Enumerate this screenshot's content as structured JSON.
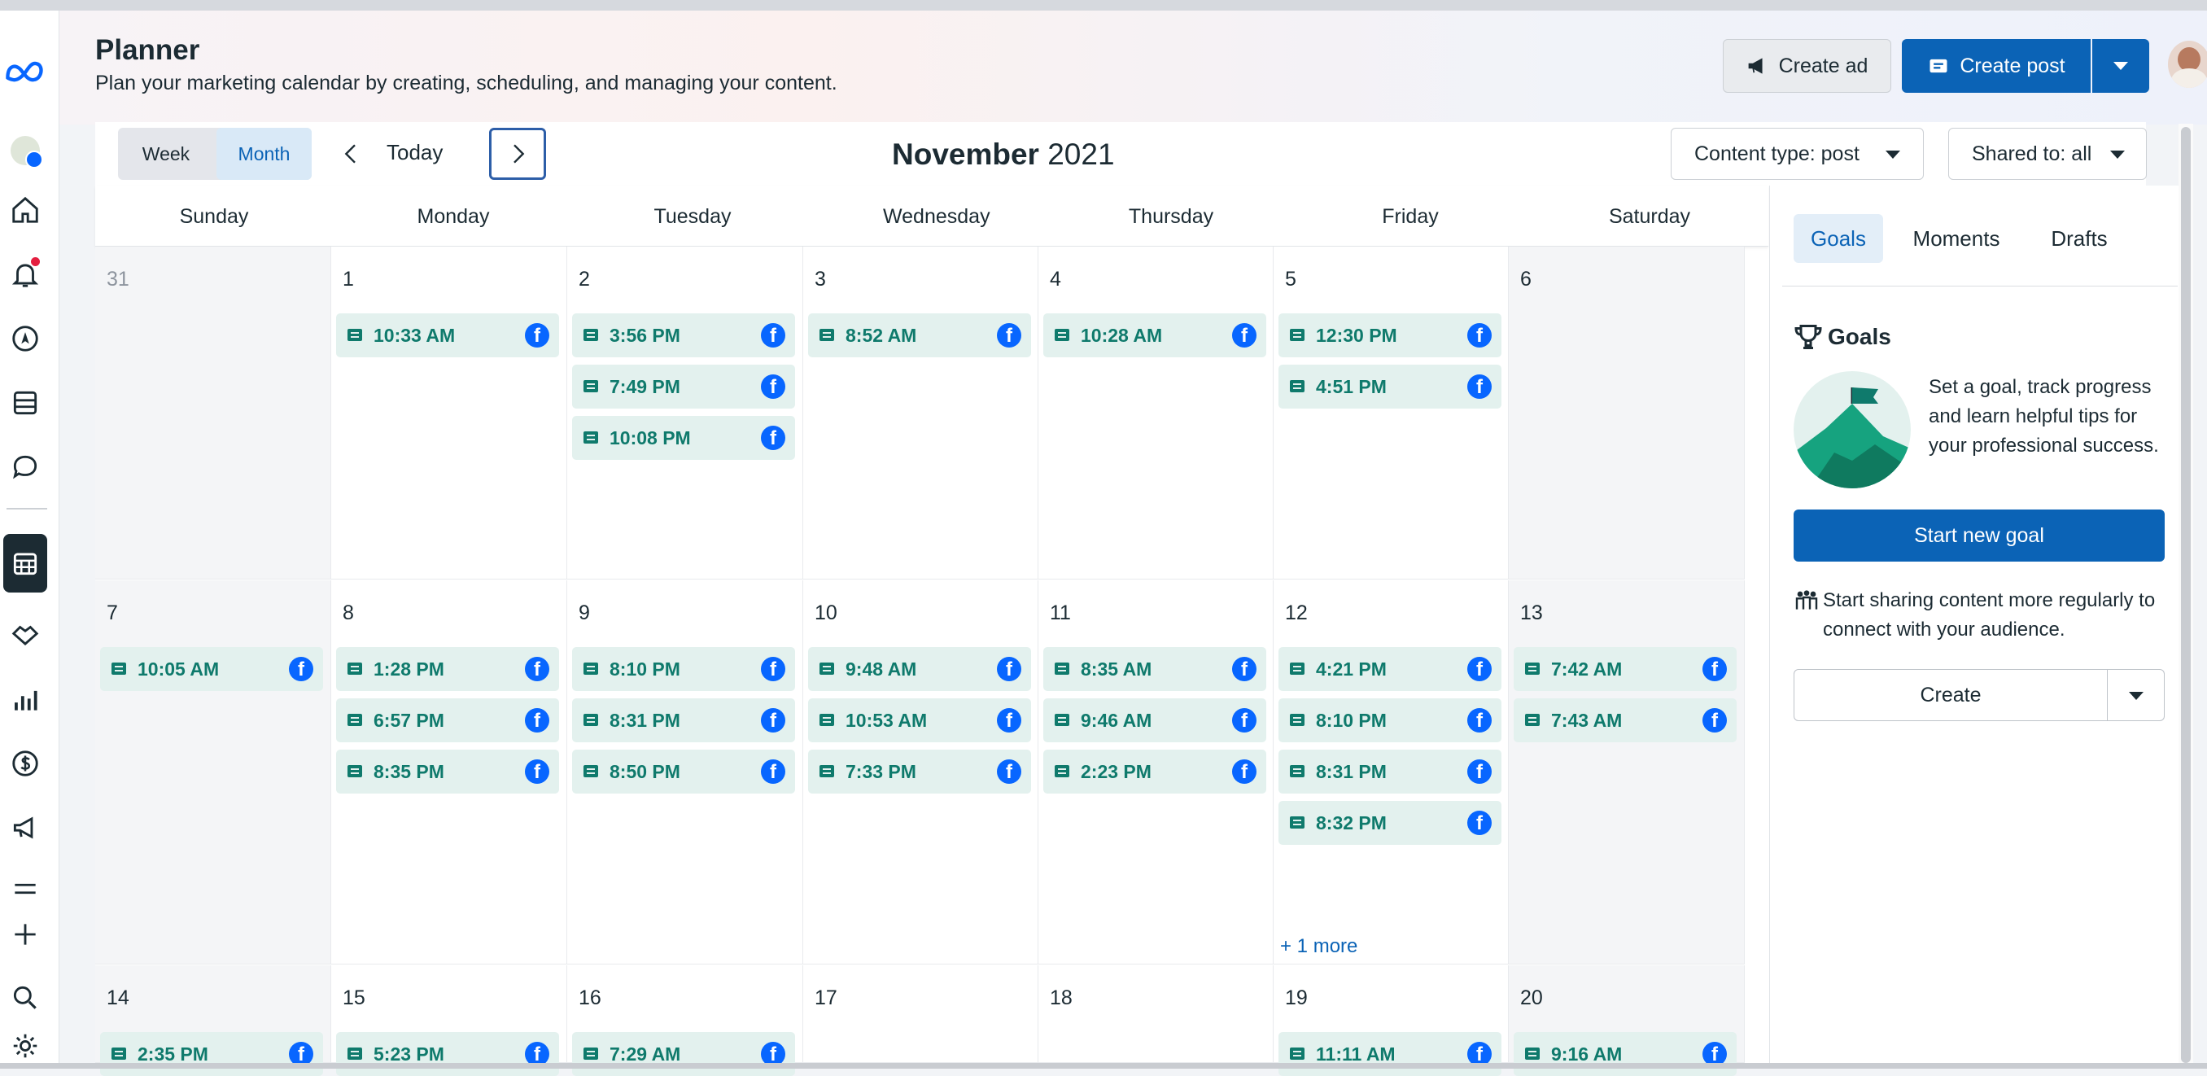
{
  "header": {
    "title": "Planner",
    "subtitle": "Plan your marketing calendar by creating, scheduling, and managing your content.",
    "create_ad_label": "Create ad",
    "create_post_label": "Create post"
  },
  "toolbar": {
    "week_label": "Week",
    "month_label": "Month",
    "today_label": "Today",
    "month_name": "November",
    "year": "2021",
    "content_type_label": "Content type: post",
    "shared_to_label": "Shared to: all"
  },
  "weekdays": [
    "Sunday",
    "Monday",
    "Tuesday",
    "Wednesday",
    "Thursday",
    "Friday",
    "Saturday"
  ],
  "weeks": [
    {
      "days": [
        {
          "num": "31",
          "muted": true,
          "events": []
        },
        {
          "num": "1",
          "events": [
            "10:33 AM"
          ]
        },
        {
          "num": "2",
          "events": [
            "3:56 PM",
            "7:49 PM",
            "10:08 PM"
          ]
        },
        {
          "num": "3",
          "events": [
            "8:52 AM"
          ]
        },
        {
          "num": "4",
          "events": [
            "10:28 AM"
          ]
        },
        {
          "num": "5",
          "events": [
            "12:30 PM",
            "4:51 PM"
          ]
        },
        {
          "num": "6",
          "events": []
        }
      ]
    },
    {
      "days": [
        {
          "num": "7",
          "events": [
            "10:05 AM"
          ]
        },
        {
          "num": "8",
          "events": [
            "1:28 PM",
            "6:57 PM",
            "8:35 PM"
          ]
        },
        {
          "num": "9",
          "events": [
            "8:10 PM",
            "8:31 PM",
            "8:50 PM"
          ]
        },
        {
          "num": "10",
          "events": [
            "9:48 AM",
            "10:53 AM",
            "7:33 PM"
          ]
        },
        {
          "num": "11",
          "events": [
            "8:35 AM",
            "9:46 AM",
            "2:23 PM"
          ]
        },
        {
          "num": "12",
          "events": [
            "4:21 PM",
            "8:10 PM",
            "8:31 PM",
            "8:32 PM"
          ],
          "more": "+ 1 more"
        },
        {
          "num": "13",
          "events": [
            "7:42 AM",
            "7:43 AM"
          ]
        }
      ]
    },
    {
      "days": [
        {
          "num": "14",
          "events": [
            "2:35 PM"
          ]
        },
        {
          "num": "15",
          "events": [
            "5:23 PM"
          ]
        },
        {
          "num": "16",
          "events": [
            "7:29 AM"
          ]
        },
        {
          "num": "17",
          "events": []
        },
        {
          "num": "18",
          "events": []
        },
        {
          "num": "19",
          "events": [
            "11:11 AM"
          ]
        },
        {
          "num": "20",
          "events": [
            "9:16 AM"
          ]
        }
      ]
    }
  ],
  "panel": {
    "tabs": [
      "Goals",
      "Moments",
      "Drafts"
    ],
    "goals_title": "Goals",
    "goals_desc": "Set a goal, track progress and learn helpful tips for your professional success.",
    "start_goal_label": "Start new goal",
    "share_text": "Start sharing content more regularly to connect with your audience.",
    "create_label": "Create"
  },
  "colors": {
    "accent": "#0b63b6",
    "event_bg": "#e3f1ee",
    "event_text": "#0f7a6c",
    "facebook": "#0866ff"
  }
}
